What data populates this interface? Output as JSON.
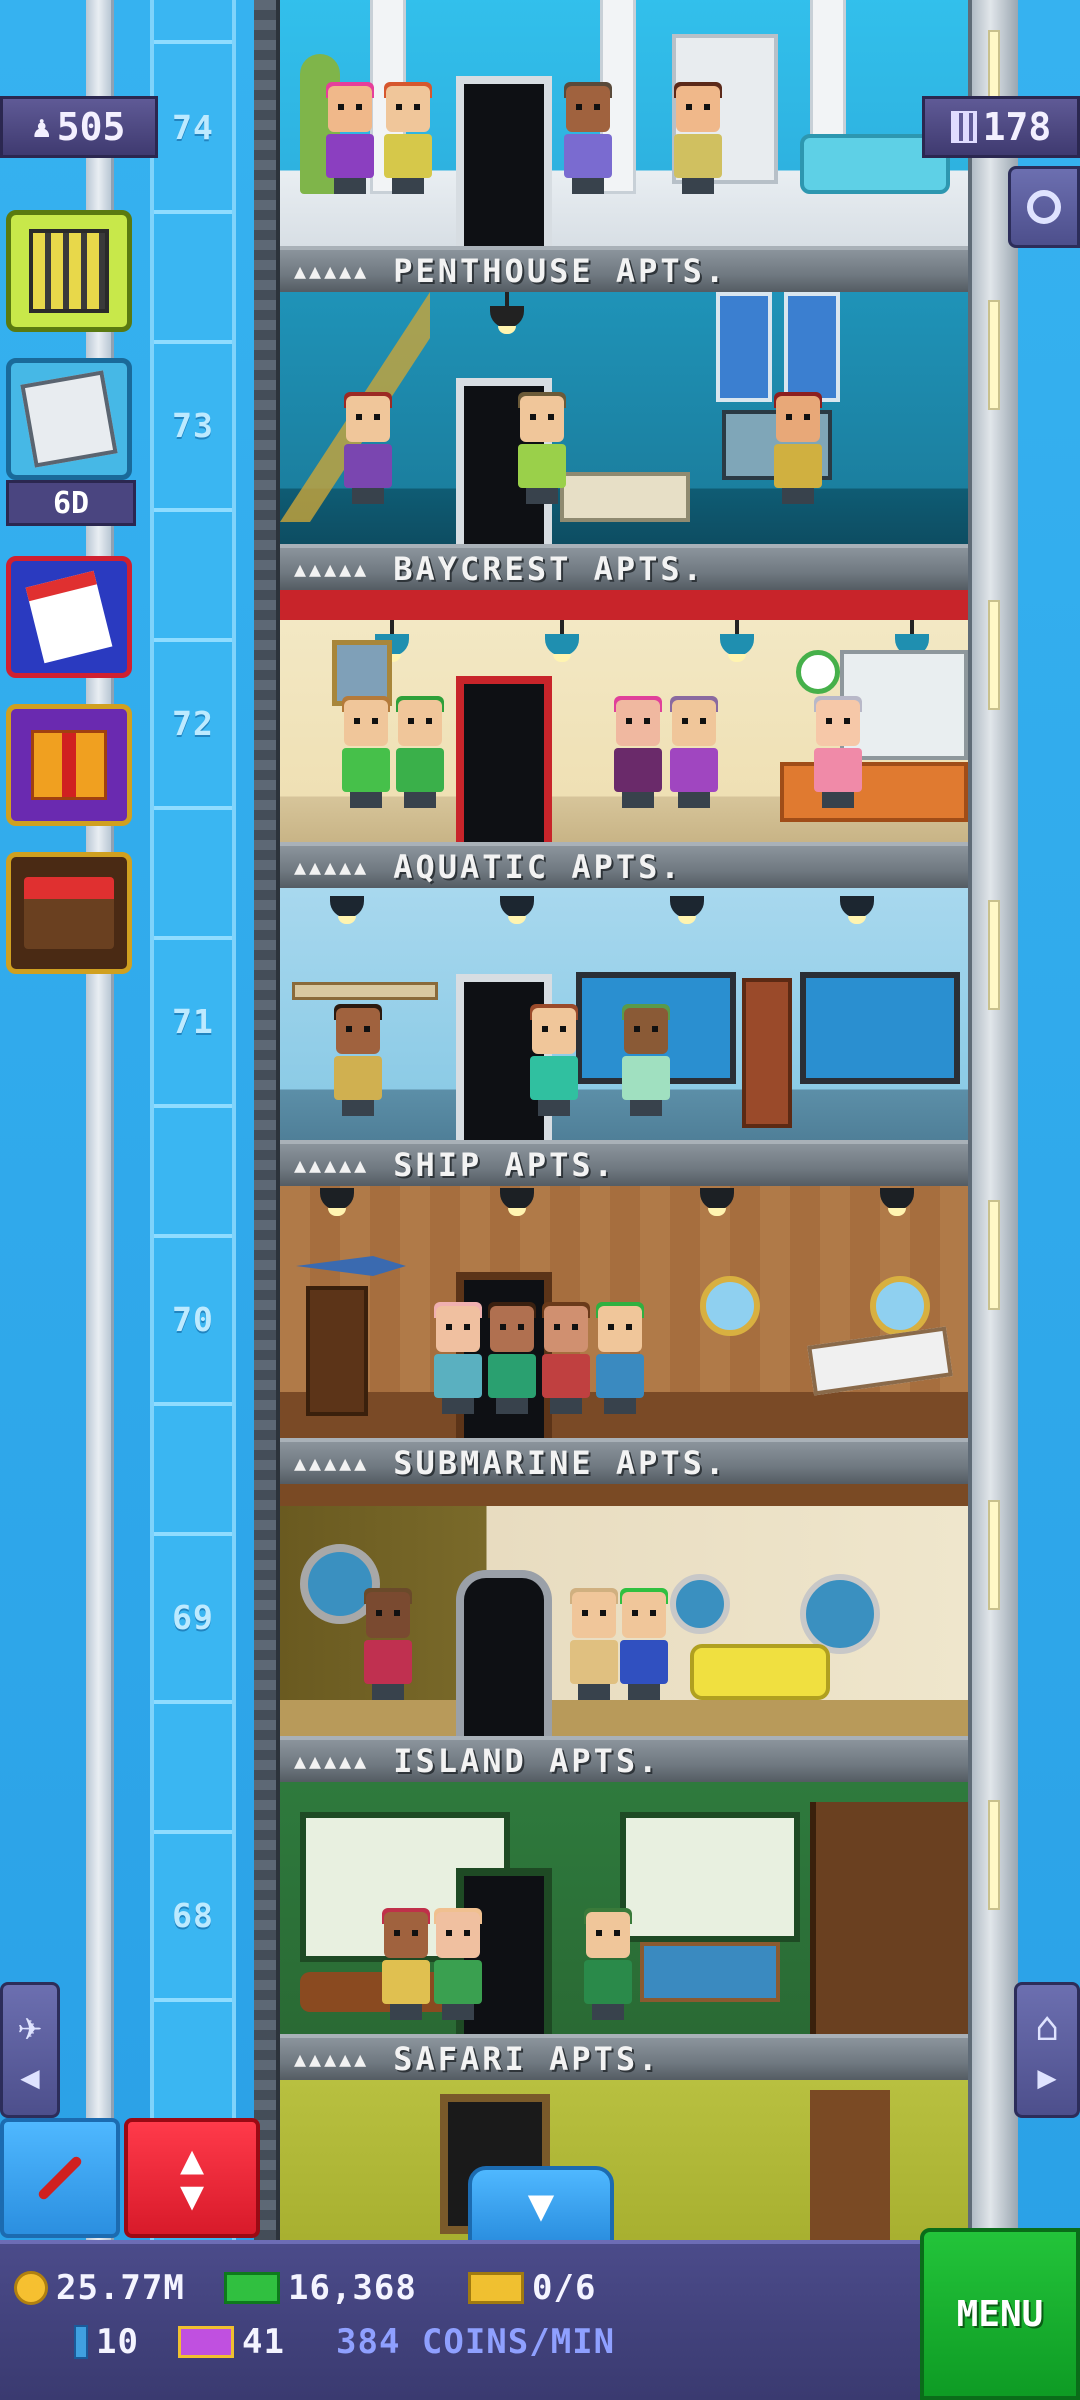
{
  "hud": {
    "population": "505",
    "floors_count": "178",
    "bitizen_timer": "6D"
  },
  "floor_numbers": [
    "74",
    "73",
    "72",
    "71",
    "70",
    "69",
    "68"
  ],
  "floors": [
    {
      "name": "PENTHOUSE APTS.",
      "stars": "▲▲▲▲▲",
      "theme": "#2db6e6"
    },
    {
      "name": "BAYCREST APTS.",
      "stars": "▲▲▲▲▲",
      "theme": "#1f8fb4"
    },
    {
      "name": "AQUATIC APTS.",
      "stars": "▲▲▲▲▲",
      "theme": "#efe3b8"
    },
    {
      "name": "SHIP APTS.",
      "stars": "▲▲▲▲▲",
      "theme": "#8ecbe4"
    },
    {
      "name": "SUBMARINE APTS.",
      "stars": "▲▲▲▲▲",
      "theme": "#a86f3e"
    },
    {
      "name": "ISLAND APTS.",
      "stars": "▲▲▲▲▲",
      "theme": "#c9a66a"
    },
    {
      "name": "SAFARI APTS.",
      "stars": "▲▲▲▲▲",
      "theme": "#2e7a3d"
    }
  ],
  "bottom": {
    "coins": "25.77M",
    "bux": "16,368",
    "tickets": "0/6",
    "keys": "10",
    "vip": "41",
    "rate": "384 COINS/MIN",
    "menu": "MENU"
  },
  "colors": {
    "menu_green": "#16b02e",
    "hud_purple": "#4b4b8a",
    "sky": "#2fa6e8"
  },
  "icons": {
    "population": "person-icon",
    "floors": "building-grid-icon",
    "search": "magnifier-icon",
    "build": "building-icon",
    "missions": "clipboard-icon",
    "calendar": "calendar-icon",
    "gift": "gift-icon",
    "shop": "market-stall-icon",
    "elevator_down": "arrow-down-icon",
    "lobby": "airplane-icon",
    "home": "home-icon",
    "pin": "pin-icon",
    "elevator": "elevator-icon"
  }
}
